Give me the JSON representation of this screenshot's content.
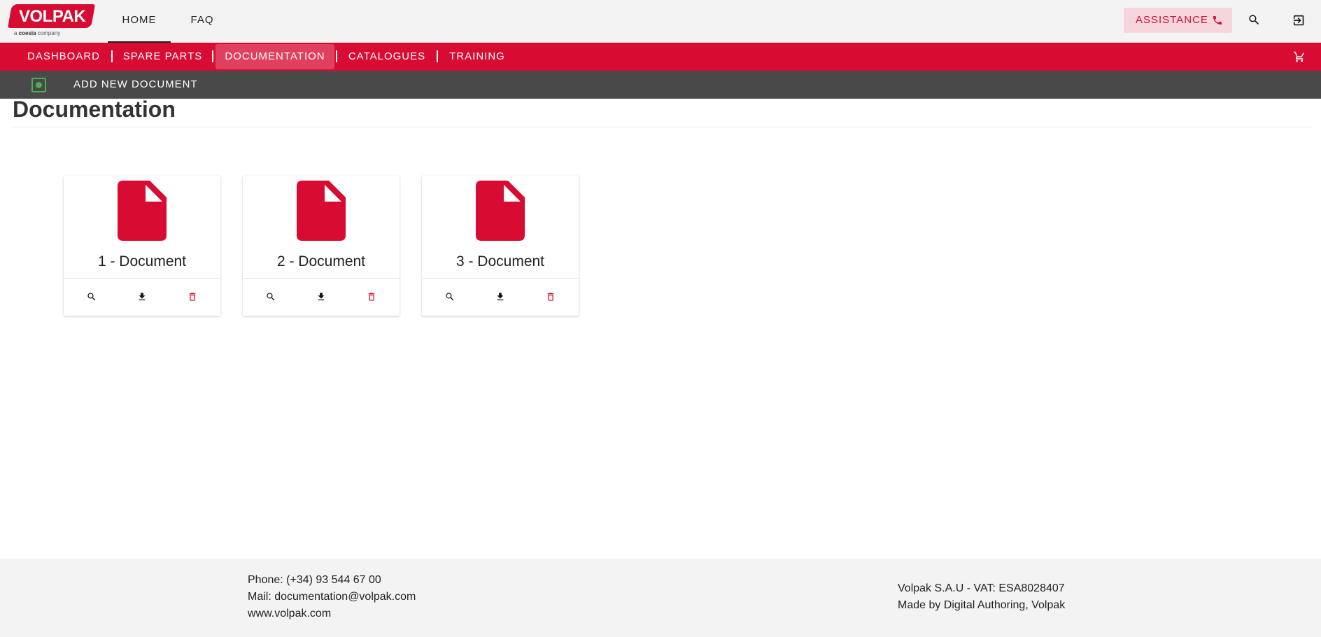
{
  "brand": {
    "logo_text": "VOLPAK",
    "logo_sub_prefix": "a ",
    "logo_sub_bold": "coesia",
    "logo_sub_suffix": " company"
  },
  "topnav": {
    "items": [
      {
        "label": "HOME"
      },
      {
        "label": "FAQ"
      }
    ],
    "active": "HOME"
  },
  "header_actions": {
    "assistance_label": "ASSISTANCE"
  },
  "icons": {
    "phone": "phone-icon",
    "search": "search-icon",
    "logout": "logout-icon",
    "cart": "cart-icon",
    "document": "document-icon",
    "view": "search-icon",
    "download": "download-icon",
    "delete": "trash-icon",
    "add": "add-icon"
  },
  "main_nav": {
    "items": [
      {
        "label": "DASHBOARD"
      },
      {
        "label": "SPARE PARTS"
      },
      {
        "label": "DOCUMENTATION"
      },
      {
        "label": "CATALOGUES"
      },
      {
        "label": "TRAINING"
      }
    ],
    "active": "DOCUMENTATION"
  },
  "toolbar": {
    "add_label": "ADD NEW DOCUMENT"
  },
  "page": {
    "title": "Documentation"
  },
  "documents": [
    {
      "title": "1 - Document"
    },
    {
      "title": "2 - Document"
    },
    {
      "title": "3 - Document"
    }
  ],
  "footer": {
    "phone": "Phone: (+34) 93 544 67 00",
    "mail": "Mail: documentation@volpak.com",
    "web": "www.volpak.com",
    "company": "Volpak S.A.U - VAT: ESA8028407",
    "made_by": "Made by Digital Authoring, Volpak"
  },
  "colors": {
    "brand_red": "#d80c32",
    "nav_active": "#e0405d",
    "toolbar": "#494949",
    "add_green": "#4caf50",
    "assist_bg": "#f6d6dc"
  }
}
